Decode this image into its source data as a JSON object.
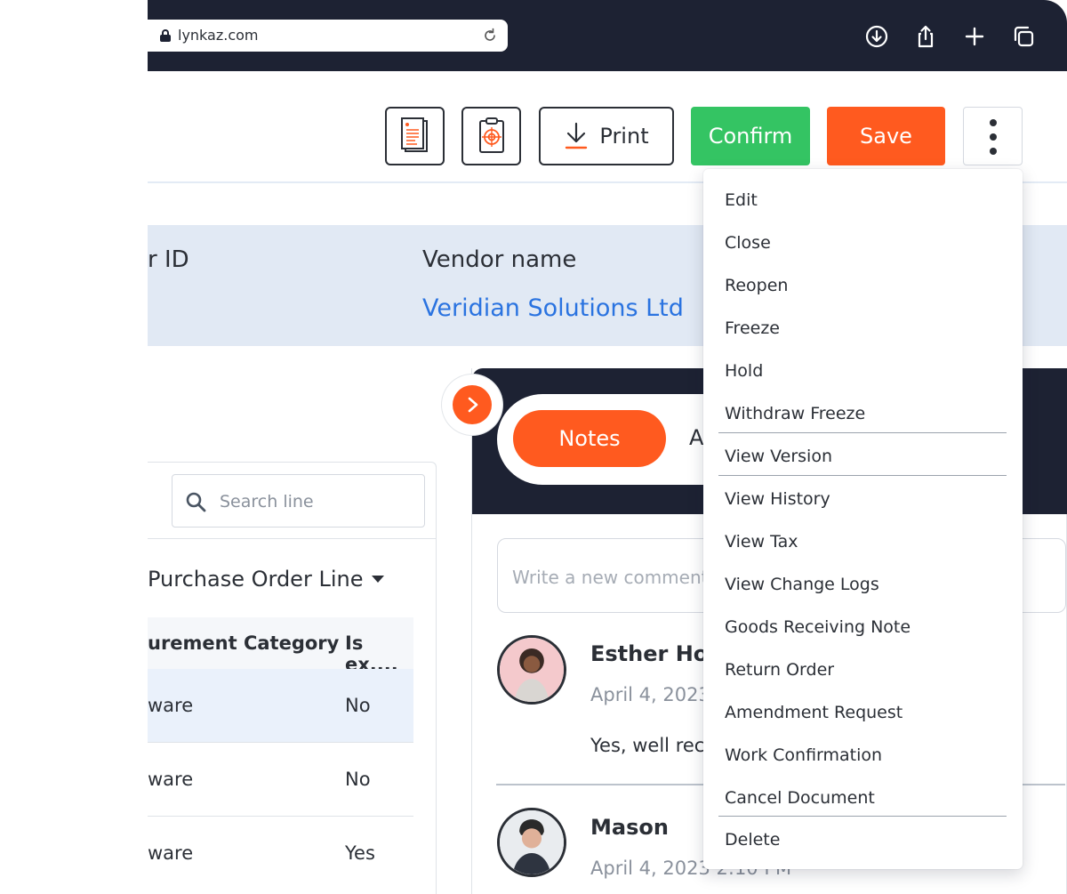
{
  "browser": {
    "url": "lynkaz.com"
  },
  "toolbar": {
    "print_label": "Print",
    "confirm_label": "Confirm",
    "save_label": "Save"
  },
  "header": {
    "id_label": "r ID",
    "vendor_label": "Vendor name",
    "vendor_value": "Veridian Solutions Ltd"
  },
  "lines": {
    "search_placeholder": "Search line",
    "title": "Purchase Order Line",
    "columns": [
      "urement Category",
      "Is ex...."
    ],
    "rows": [
      {
        "category": "ware",
        "is_ex": "No"
      },
      {
        "category": "ware",
        "is_ex": "No"
      },
      {
        "category": "ware",
        "is_ex": "Yes"
      }
    ]
  },
  "notes": {
    "tabs": [
      "Notes",
      "A"
    ],
    "comment_placeholder": "Write a new comment",
    "comments": [
      {
        "author": "Esther How",
        "date": "April 4, 2023",
        "text": "Yes, well rece"
      },
      {
        "author": "Mason",
        "date": "April 4, 2023 2:10 PM",
        "text": ""
      }
    ]
  },
  "menu": {
    "items": [
      "Edit",
      "Close",
      "Reopen",
      "Freeze",
      "Hold",
      "Withdraw Freeze",
      "View Version",
      "View History",
      "View Tax",
      "View Change Logs",
      "Goods Receiving Note",
      "Return Order",
      "Amendment Request",
      "Work Confirmation",
      "Cancel Document",
      "Delete"
    ]
  },
  "colors": {
    "accent": "#ff5a1f",
    "confirm": "#34c463",
    "chrome": "#1d2233",
    "link": "#2a73e0",
    "band": "#e1e9f4"
  },
  "icons": [
    "lock-icon",
    "reload-icon",
    "download-icon",
    "share-icon",
    "plus-icon",
    "tabs-icon",
    "document-icon",
    "target-clipboard-icon",
    "download-arrow-icon",
    "more-vertical-icon",
    "search-icon",
    "caret-down-icon",
    "chevron-right-icon"
  ]
}
